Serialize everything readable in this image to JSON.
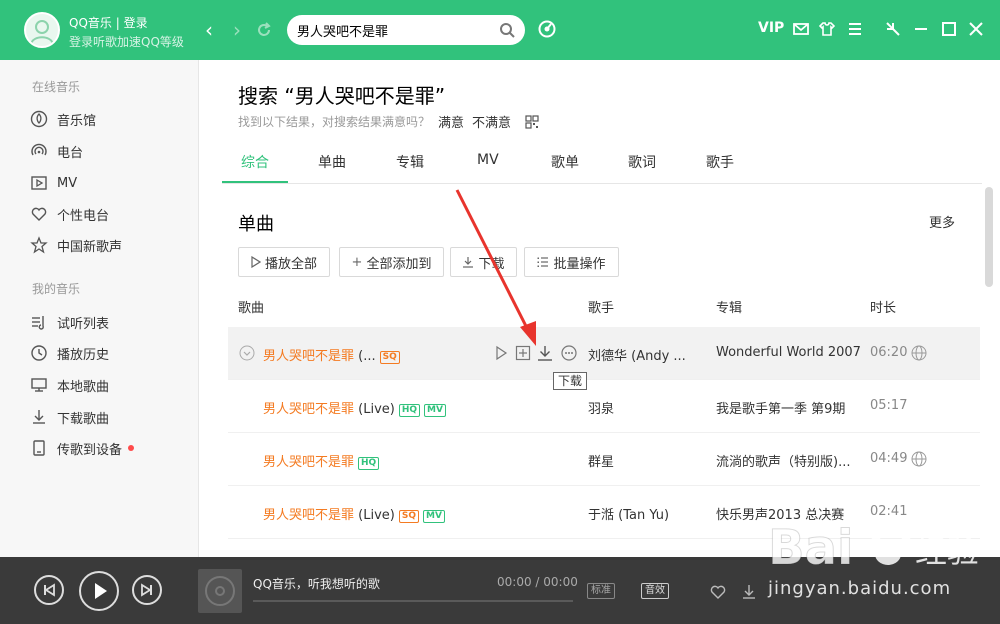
{
  "header": {
    "user_name": "QQ音乐 | 登录",
    "user_sub": "登录听歌加速QQ等级",
    "search_value": "男人哭吧不是罪",
    "vip_label": "VIP"
  },
  "sidebar": {
    "online_section": "在线音乐",
    "online_items": [
      {
        "label": "音乐馆",
        "icon": "music-hall-icon"
      },
      {
        "label": "电台",
        "icon": "radio-icon"
      },
      {
        "label": "MV",
        "icon": "mv-icon"
      },
      {
        "label": "个性电台",
        "icon": "heart-radio-icon"
      },
      {
        "label": "中国新歌声",
        "icon": "star-icon"
      }
    ],
    "my_section": "我的音乐",
    "my_items": [
      {
        "label": "试听列表",
        "icon": "playlist-icon"
      },
      {
        "label": "播放历史",
        "icon": "clock-icon"
      },
      {
        "label": "本地歌曲",
        "icon": "computer-icon"
      },
      {
        "label": "下载歌曲",
        "icon": "download-icon"
      },
      {
        "label": "传歌到设备",
        "icon": "device-icon"
      }
    ]
  },
  "main": {
    "search_title": "搜索 “男人哭吧不是罪”",
    "hint": "找到以下结果，对搜索结果满意吗？",
    "hint_yes": "满意",
    "hint_no": "不满意",
    "tabs": [
      "综合",
      "单曲",
      "专辑",
      "MV",
      "歌单",
      "歌词",
      "歌手"
    ],
    "section_title": "单曲",
    "more": "更多",
    "buttons": {
      "play_all": "播放全部",
      "add_all": "全部添加到",
      "download": "下载",
      "batch": "批量操作"
    },
    "columns": {
      "song": "歌曲",
      "singer": "歌手",
      "album": "专辑",
      "duration": "时长"
    },
    "rows": [
      {
        "name": "男人哭吧不是罪",
        "extra": " (...",
        "tags": [
          "SQ"
        ],
        "singer": "刘德华 (Andy ...",
        "album": "Wonderful World 2007...",
        "duration": "06:20"
      },
      {
        "name": "男人哭吧不是罪",
        "extra": " (Live)",
        "tags": [
          "HQ",
          "MV"
        ],
        "singer": "羽泉",
        "album": "我是歌手第一季 第9期",
        "duration": "05:17"
      },
      {
        "name": "男人哭吧不是罪",
        "extra": "",
        "tags": [
          "HQ"
        ],
        "singer": "群星",
        "album": "流淌的歌声（特别版)...",
        "duration": "04:49"
      },
      {
        "name": "男人哭吧不是罪",
        "extra": " (Live)",
        "tags": [
          "SQ",
          "MV"
        ],
        "singer": "于湉 (Tan Yu)",
        "album": "快乐男声2013 总决赛",
        "duration": "02:41"
      }
    ],
    "tooltip": "下载"
  },
  "player": {
    "now_playing": "QQ音乐，听我想听的歌",
    "time": "00:00 / 00:00",
    "quality": "标准",
    "effect": "音效"
  },
  "watermark": {
    "brand": "Baidu经验",
    "url": "jingyan.baidu.com"
  },
  "colors": {
    "accent": "#31c27c",
    "song": "#f47b22",
    "player_bg": "#3a3a3a",
    "arrow": "#e8342d"
  }
}
